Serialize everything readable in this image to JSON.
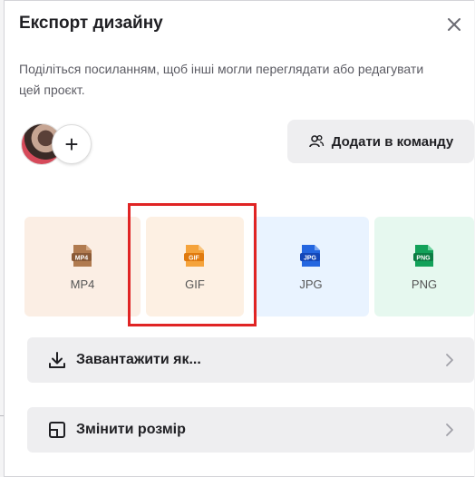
{
  "dialog": {
    "title": "Експорт дизайну",
    "description": "Поділіться посиланням, щоб інші могли переглядати або редагувати цей проєкт.",
    "close_icon": "close-icon"
  },
  "team": {
    "add_member_symbol": "+",
    "add_to_team_label": "Додати в команду",
    "add_to_team_icon": "people-icon"
  },
  "formats": [
    {
      "label": "MP4",
      "badge": "MP4",
      "color": "#b07a4f",
      "bg": "#fbeee4"
    },
    {
      "label": "GIF",
      "badge": "GIF",
      "color": "#f28a1c",
      "bg": "#fdf0e3"
    },
    {
      "label": "JPG",
      "badge": "JPG",
      "color": "#2466e0",
      "bg": "#e9f3ff"
    },
    {
      "label": "PNG",
      "badge": "PNG",
      "color": "#12a159",
      "bg": "#e6f8ef"
    }
  ],
  "actions": {
    "download_label": "Завантажити як...",
    "download_icon": "download-icon",
    "resize_label": "Змінити розмір",
    "resize_icon": "resize-icon"
  },
  "colors": {
    "highlight": "#e02424",
    "text": "#1f1f23",
    "muted": "#5b5b63"
  }
}
